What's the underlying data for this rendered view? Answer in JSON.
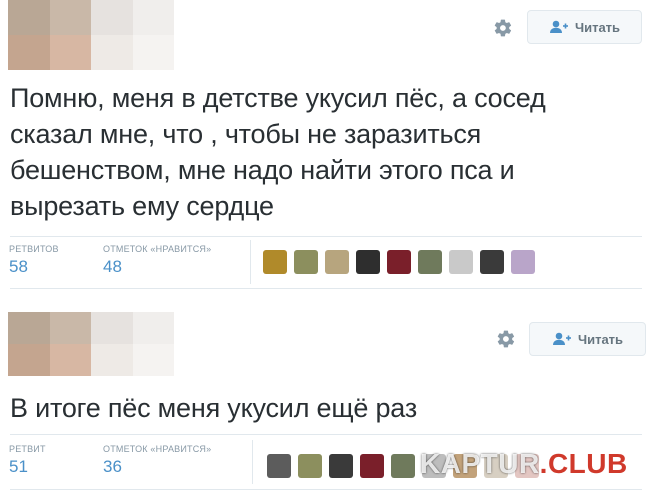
{
  "tweets": [
    {
      "follow_label": "Читать",
      "text": "Помню, меня в детстве укусил пёс, а сосед сказал мне, что , чтобы не заразиться бешенством, мне надо найти этого пса и вырезать ему сердце",
      "retweets_label": "РЕТВИТОВ",
      "retweets_value": "58",
      "likes_label": "ОТМЕТОК «НРАВИТСЯ»",
      "likes_value": "48",
      "liker_colors": [
        "#b08a2a",
        "#8c8f5e",
        "#b7a57e",
        "#2e2e2e",
        "#7a1f2a",
        "#6f7a5c",
        "#c9c9c9",
        "#3a3a3a",
        "#b9a5c9"
      ]
    },
    {
      "follow_label": "Читать",
      "text": "В итоге пёс меня укусил ещё раз",
      "retweets_label": "РЕТВИТ",
      "retweets_value": "51",
      "likes_label": "ОТМЕТОК «НРАВИТСЯ»",
      "likes_value": "36",
      "liker_colors": [
        "#5c5c5c",
        "#8c8f5e",
        "#3a3a3a",
        "#7a1f2a",
        "#6f7a5c",
        "#bdbdbd",
        "#c2a27a",
        "#d7cfc2",
        "#e3c6c2"
      ]
    }
  ],
  "avatar_colors": [
    "#b9a795",
    "#c9b8a8",
    "#e6e2df",
    "#f0eeec",
    "#c4a58f",
    "#d7b7a3",
    "#eeeae6",
    "#f5f3f1"
  ],
  "watermark": {
    "prefix": "KAPTUR",
    "dot": ".",
    "suffix": "CLUB"
  },
  "icons": {
    "gear": "gear-icon",
    "follow": "add-user-icon"
  }
}
